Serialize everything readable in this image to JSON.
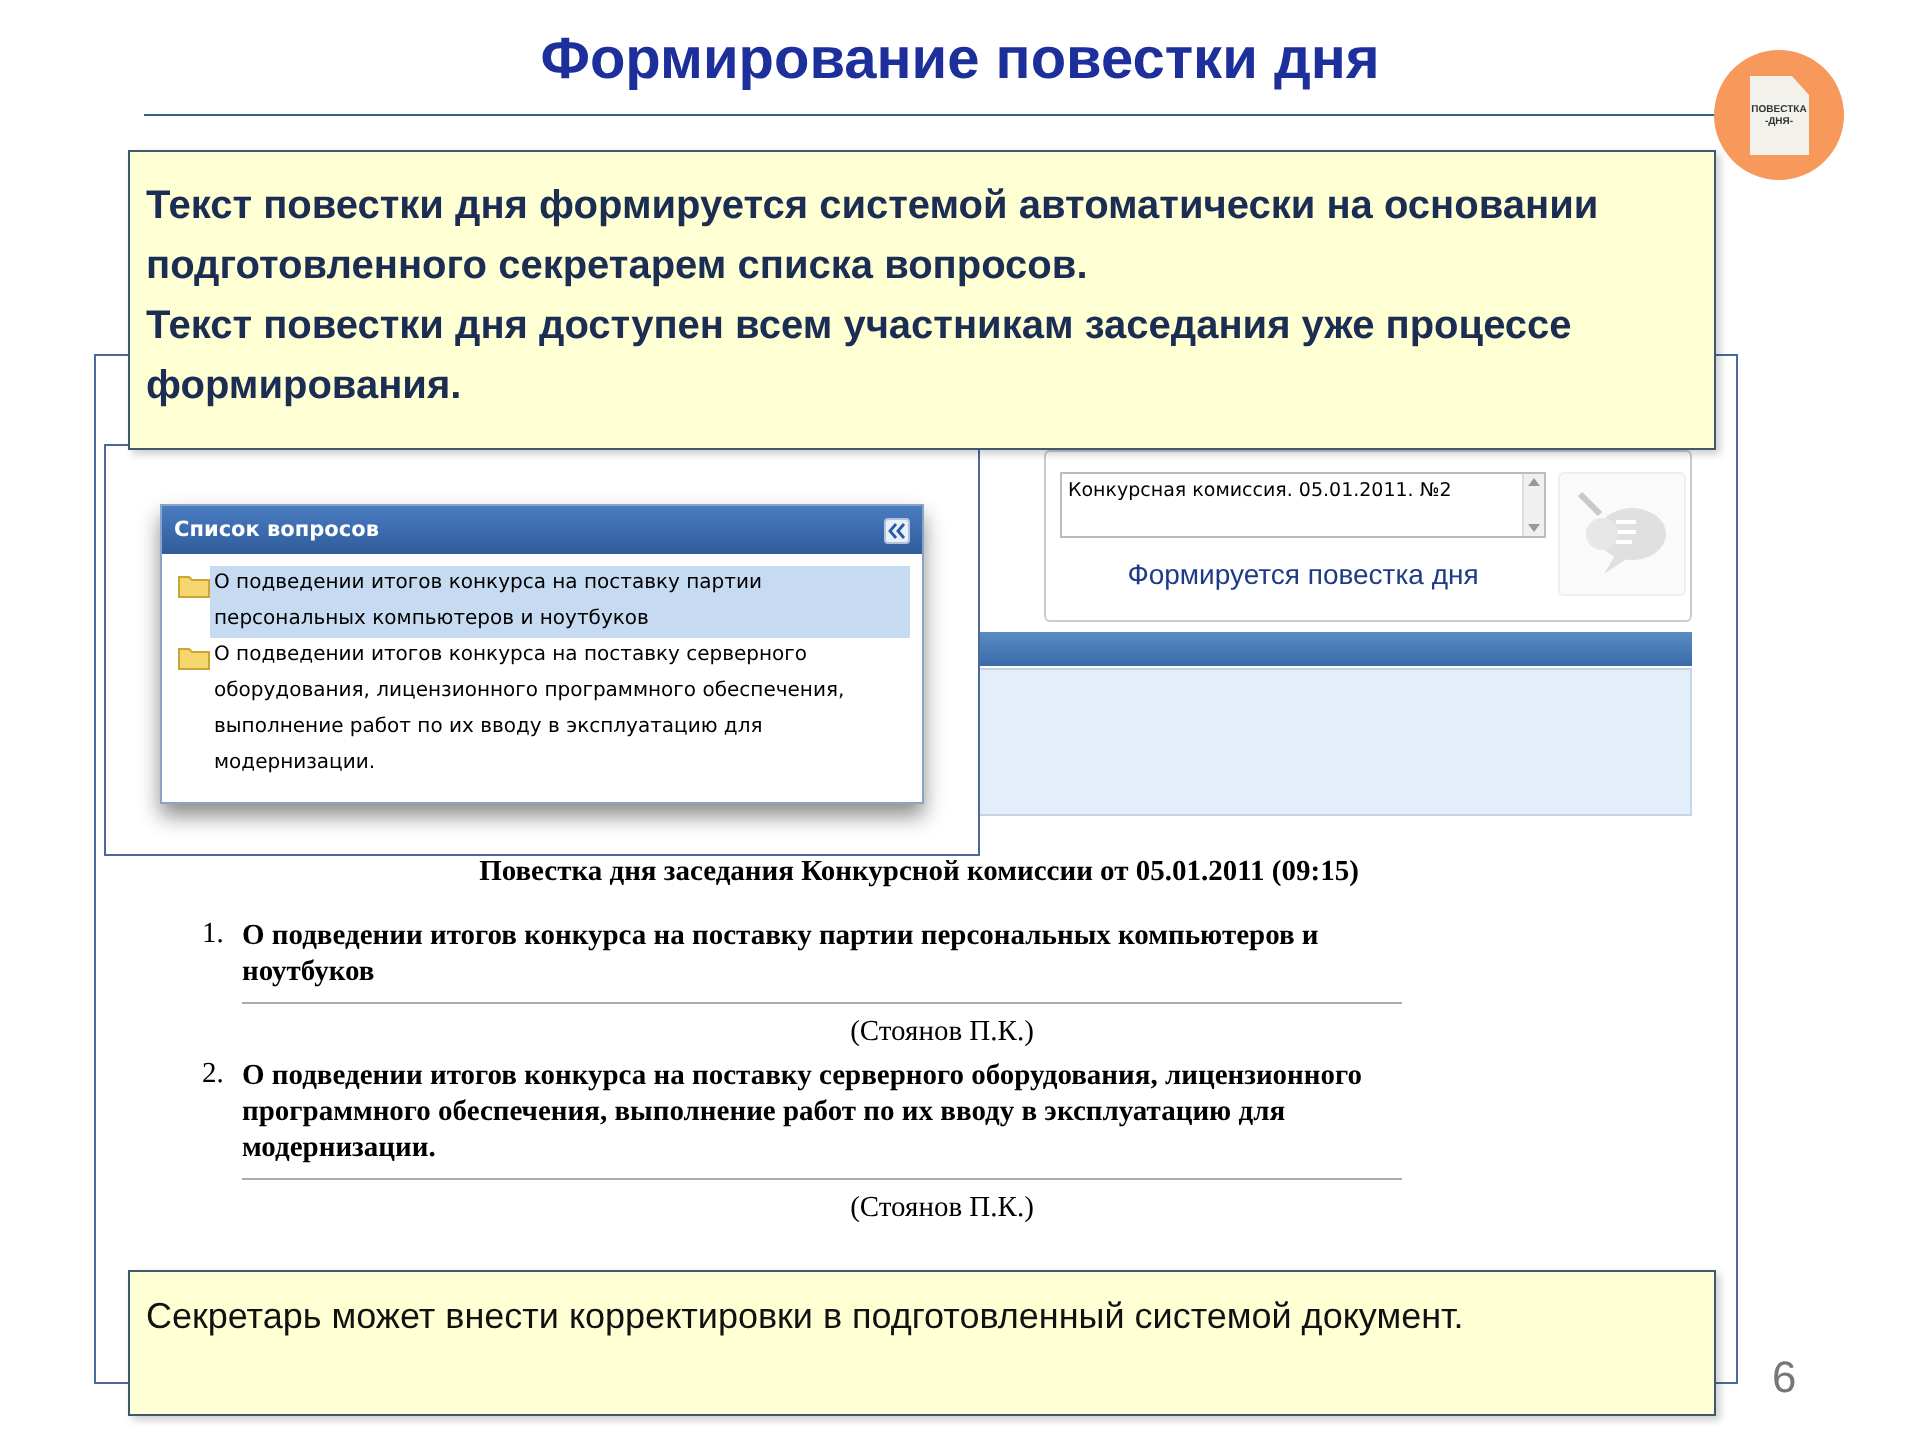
{
  "slide": {
    "title": "Формирование повестки дня",
    "badge": {
      "lines": [
        "ПОВЕСТКА",
        "-ДНЯ-"
      ]
    },
    "page_number": "6"
  },
  "callout_top": {
    "paragraphs": [
      "Текст повестки дня формируется системой автоматически на основании подготовленного секретарем списка вопросов.",
      "Текст повестки дня доступен всем участникам заседания уже процессе формирования."
    ]
  },
  "app": {
    "meeting_field": {
      "value": "Конкурсная комиссия. 05.01.2011. №2"
    },
    "status": "Формируется повестка дня",
    "action_button": {
      "disabled": true
    },
    "agenda": {
      "title": "Повестка дня заседания Конкурсной комиссии от 05.01.2011 (09:15)",
      "items": [
        {
          "number": "1.",
          "text": "О подведении итогов конкурса на поставку партии персональных компьютеров и ноутбуков",
          "speaker": "(Стоянов П.К.)"
        },
        {
          "number": "2.",
          "text": "О подведении итогов конкурса на поставку серверного оборудования, лицензионного программного обеспечения, выполнение работ по их вводу в эксплуатацию для модернизации.",
          "speaker": "(Стоянов П.К.)"
        }
      ]
    }
  },
  "questions_dialog": {
    "title": "Список вопросов",
    "items": [
      {
        "text": "О подведении итогов конкурса на поставку партии персональных компьютеров и ноутбуков",
        "selected": true
      },
      {
        "text": "О подведении итогов конкурса на поставку серверного оборудования, лицензионного программного обеспечения, выполнение работ по их вводу в эксплуатацию для модернизации.",
        "selected": false
      }
    ]
  },
  "callout_bottom": {
    "text": "Секретарь может внести корректировки в подготовленный системой документ."
  }
}
